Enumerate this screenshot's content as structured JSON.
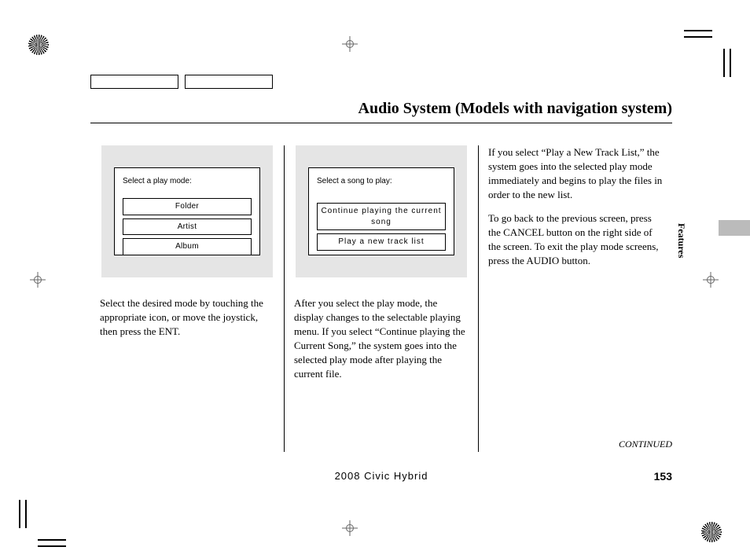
{
  "title": "Audio System (Models with navigation system)",
  "screen1": {
    "label": "Select a play mode:",
    "options": [
      "Folder",
      "Artist",
      "Album"
    ]
  },
  "screen2": {
    "label": "Select a song to play:",
    "options": [
      "Continue playing the  current  song",
      "Play a  new  track  list"
    ]
  },
  "col1_text": "Select the desired mode by touching the appropriate icon, or move the joystick, then press the ENT.",
  "col2_text": "After you select the play mode, the display changes to the selectable playing menu. If you select “Continue playing the Current Song,” the system goes into the selected play mode after playing the current file.",
  "col3_p1": "If you select “Play a New Track List,” the system goes into the selected play mode immediately and begins to play the files in order to the new list.",
  "col3_p2": "To go back to the previous screen, press the CANCEL button on the right side of the screen. To exit the play mode screens, press the AUDIO button.",
  "continued": "CONTINUED",
  "model": "2008  Civic  Hybrid",
  "page_number": "153",
  "side_label": "Features"
}
